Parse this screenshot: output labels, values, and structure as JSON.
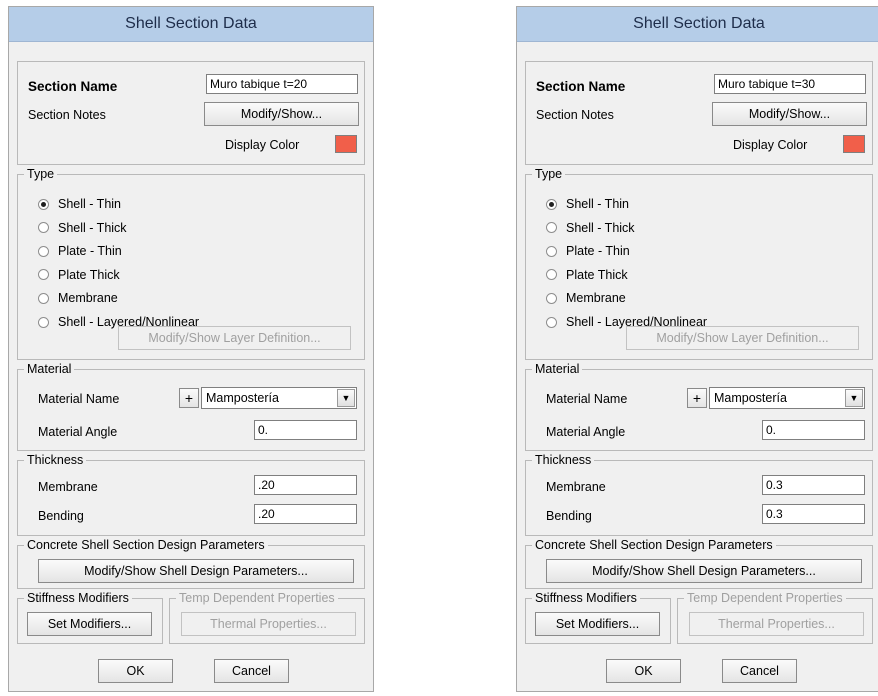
{
  "dialogs": [
    {
      "title": "Shell Section Data",
      "section_name_label": "Section Name",
      "section_name_value": "Muro tabique t=20",
      "section_notes_label": "Section Notes",
      "modify_show_label": "Modify/Show...",
      "display_color_label": "Display Color",
      "display_color": "#f15f4a",
      "type_legend": "Type",
      "type_options": [
        "Shell - Thin",
        "Shell - Thick",
        "Plate - Thin",
        "Plate Thick",
        "Membrane",
        "Shell - Layered/Nonlinear"
      ],
      "type_selected": "Shell - Thin",
      "layer_button_label": "Modify/Show Layer Definition...",
      "material_legend": "Material",
      "material_name_label": "Material Name",
      "plus_label": "+",
      "material_name_value": "Mampostería",
      "material_angle_label": "Material Angle",
      "material_angle_value": "0.",
      "thickness_legend": "Thickness",
      "membrane_label": "Membrane",
      "membrane_value": ".20",
      "bending_label": "Bending",
      "bending_value": ".20",
      "concrete_legend": "Concrete Shell Section Design Parameters",
      "design_button_label": "Modify/Show Shell Design Parameters...",
      "stiffness_legend": "Stiffness Modifiers",
      "set_modifiers_label": "Set Modifiers...",
      "temp_legend": "Temp Dependent Properties",
      "thermal_label": "Thermal Properties...",
      "ok_label": "OK",
      "cancel_label": "Cancel"
    },
    {
      "title": "Shell Section Data",
      "section_name_label": "Section Name",
      "section_name_value": "Muro tabique t=30",
      "section_notes_label": "Section Notes",
      "modify_show_label": "Modify/Show...",
      "display_color_label": "Display Color",
      "display_color": "#f15f4a",
      "type_legend": "Type",
      "type_options": [
        "Shell - Thin",
        "Shell - Thick",
        "Plate - Thin",
        "Plate Thick",
        "Membrane",
        "Shell - Layered/Nonlinear"
      ],
      "type_selected": "Shell - Thin",
      "layer_button_label": "Modify/Show Layer Definition...",
      "material_legend": "Material",
      "material_name_label": "Material Name",
      "plus_label": "+",
      "material_name_value": "Mampostería",
      "material_angle_label": "Material Angle",
      "material_angle_value": "0.",
      "thickness_legend": "Thickness",
      "membrane_label": "Membrane",
      "membrane_value": "0.3",
      "bending_label": "Bending",
      "bending_value": "0.3",
      "concrete_legend": "Concrete Shell Section Design Parameters",
      "design_button_label": "Modify/Show Shell Design Parameters...",
      "stiffness_legend": "Stiffness Modifiers",
      "set_modifiers_label": "Set Modifiers...",
      "temp_legend": "Temp Dependent Properties",
      "thermal_label": "Thermal Properties...",
      "ok_label": "OK",
      "cancel_label": "Cancel"
    }
  ]
}
